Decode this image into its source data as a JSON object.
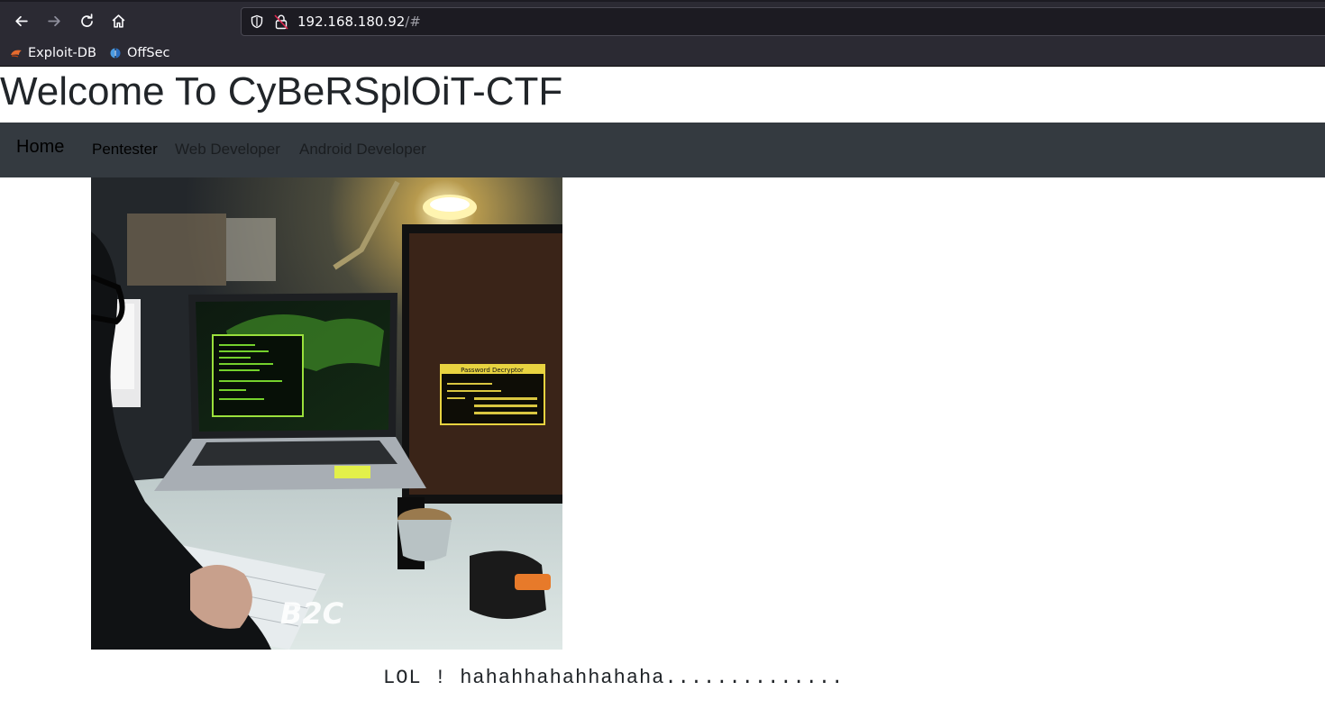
{
  "browser": {
    "url_host": "192.168.180.92",
    "url_hash": "/#",
    "bookmarks": [
      {
        "label": "Exploit-DB",
        "icon": "exploit-db-icon"
      },
      {
        "label": "OffSec",
        "icon": "offsec-icon"
      }
    ],
    "colors": {
      "chrome": "#2b2a33",
      "urlbar": "#1c1b22",
      "text": "#fbfbfe"
    }
  },
  "page": {
    "heading": "Welcome To CyBeRSplOiT-CTF",
    "navbar": {
      "brand": "Home",
      "links": [
        {
          "label": "Pentester",
          "state": "active"
        },
        {
          "label": "Web Developer",
          "state": "muted"
        },
        {
          "label": "Android Developer",
          "state": "muted"
        }
      ],
      "background": "#343a40"
    },
    "image": {
      "watermark": "B2C",
      "popup_title": "Password Decryptor"
    },
    "message": "LOL ! hahahhahahhahaha.............."
  }
}
